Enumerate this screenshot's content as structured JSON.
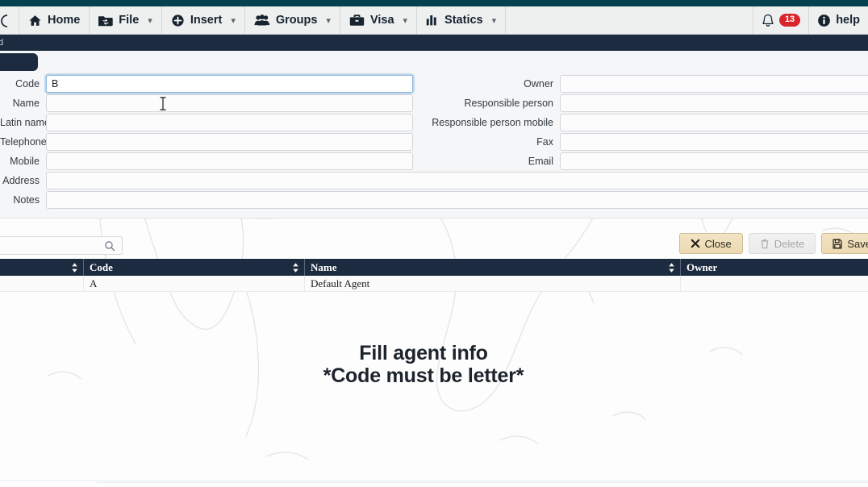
{
  "topbar": {
    "strip_color": "#04414d",
    "menu_items": [
      {
        "label": "",
        "icon": "circle-partial-icon",
        "caret": false,
        "partial": true
      },
      {
        "label": "Home",
        "icon": "home-icon",
        "caret": false,
        "partial": false
      },
      {
        "label": "File",
        "icon": "folder-exchange-icon",
        "caret": true,
        "partial": false
      },
      {
        "label": "Insert",
        "icon": "plus-circle-icon",
        "caret": true,
        "partial": false
      },
      {
        "label": "Groups",
        "icon": "users-icon",
        "caret": true,
        "partial": false
      },
      {
        "label": "Visa",
        "icon": "briefcase-icon",
        "caret": true,
        "partial": false
      },
      {
        "label": "Statics",
        "icon": "bar-chart-icon",
        "caret": true,
        "partial": false
      }
    ],
    "notification_icon": "bell-icon",
    "notification_count": "13",
    "notification_badge_color": "#d9242a",
    "help_icon": "info-circle-icon",
    "help_label": "help"
  },
  "darkband": {
    "text": "d"
  },
  "form": {
    "tab_label": "",
    "left_fields": [
      {
        "label": "Code",
        "value": "B",
        "placeholder": "",
        "focused": true
      },
      {
        "label": "Name",
        "value": "",
        "placeholder": "",
        "focused": false
      },
      {
        "label": "Latin name",
        "value": "",
        "placeholder": "",
        "focused": false
      },
      {
        "label": "Telephone",
        "value": "",
        "placeholder": "",
        "focused": false
      },
      {
        "label": "Mobile",
        "value": "",
        "placeholder": "",
        "focused": false
      }
    ],
    "right_fields": [
      {
        "label": "Owner",
        "value": "",
        "placeholder": ""
      },
      {
        "label": "Responsible person",
        "value": "",
        "placeholder": ""
      },
      {
        "label": "Responsible person mobile",
        "value": "",
        "placeholder": ""
      },
      {
        "label": "Fax",
        "value": "",
        "placeholder": ""
      },
      {
        "label": "Email",
        "value": "",
        "placeholder": ""
      }
    ],
    "wide_fields": [
      {
        "label": "Address",
        "value": "",
        "placeholder": ""
      },
      {
        "label": "Notes",
        "value": "",
        "placeholder": ""
      }
    ]
  },
  "toolbar": {
    "search_value": "",
    "search_placeholder": "",
    "search_icon": "magnifier-icon",
    "close_label": "Close",
    "close_icon": "x-icon",
    "delete_label": "Delete",
    "delete_icon": "trash-icon",
    "delete_disabled": true,
    "save_label": "Save",
    "save_icon": "floppy-disk-icon",
    "button_color": "#ecd9b1"
  },
  "table": {
    "columns": [
      "",
      "Code",
      "Name",
      "Owner"
    ],
    "rows": [
      {
        "c0": "",
        "code": "A",
        "name": "Default Agent",
        "owner": ""
      }
    ]
  },
  "overlay": {
    "line1": "Fill agent info",
    "line2": "*Code must be letter*"
  }
}
